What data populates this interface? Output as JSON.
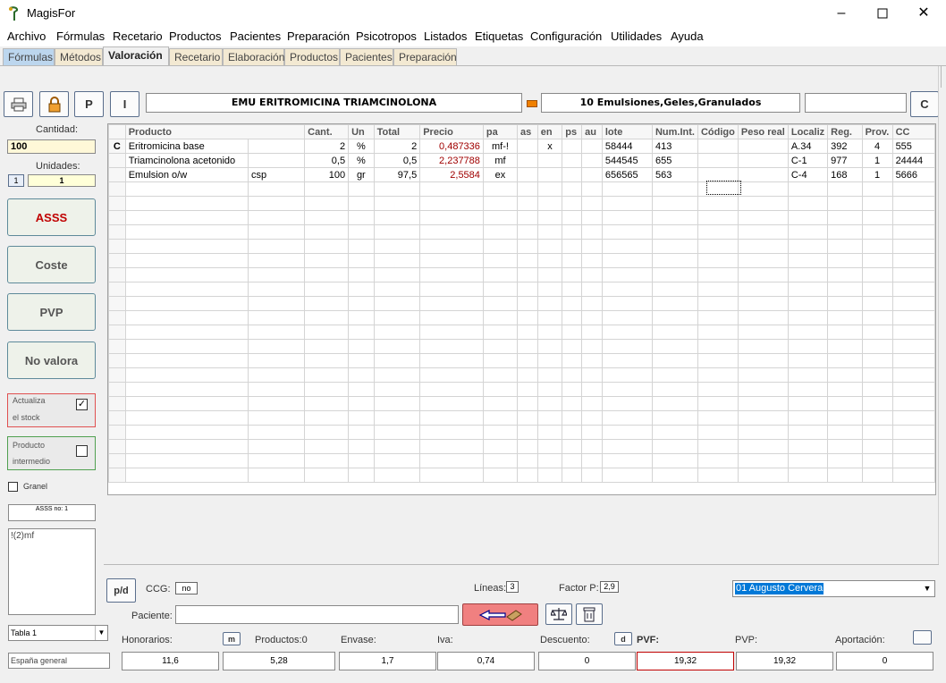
{
  "window": {
    "title": "MagisFor"
  },
  "menu": [
    "Archivo",
    "Fórmulas",
    "Recetario",
    "Productos",
    "Pacientes",
    "Preparación",
    "Psicotropos",
    "Listados",
    "Etiquetas",
    "Configuración",
    "Utilidades",
    "Ayuda"
  ],
  "tabs": [
    "Fórmulas",
    "Métodos",
    "Valoración",
    "Recetario",
    "Elaboración",
    "Productos",
    "Pacientes",
    "Preparación"
  ],
  "toolbar": {
    "p_label": "P",
    "i_label": "I",
    "formula_name": "EMU ERITROMICINA TRIAMCINOLONA",
    "form_type": "10 Emulsiones,Geles,Granulados",
    "c_label": "C"
  },
  "left": {
    "cantidad_label": "Cantidad:",
    "cantidad_value": "100",
    "unidades_label": "Unidades:",
    "unidades_small": "1",
    "unidades_value": "1",
    "btn_asss": "ASSS",
    "btn_coste": "Coste",
    "btn_pvp": "PVP",
    "btn_no_valora": "No valora",
    "actualiza_line1": "Actualiza",
    "actualiza_line2": "el stock",
    "intermedio_line1": "Producto",
    "intermedio_line2": "intermedio",
    "granel_label": "Granel",
    "asss_no": "ASSS no: 1",
    "notes": "!(2)mf",
    "tabla_value": "Tabla 1",
    "region_value": "España general"
  },
  "grid": {
    "columns": [
      "",
      "Producto",
      "Cant.",
      "Un",
      "Total",
      "Precio",
      "pa",
      "as",
      "en",
      "ps",
      "au",
      "lote",
      "Num.Int.",
      "Código",
      "Peso real",
      "Localiz",
      "Reg.",
      "Prov.",
      "CC"
    ],
    "rows": [
      [
        "C",
        "Eritromicina base",
        "",
        "2",
        "%",
        "2",
        "0,487336",
        "mf-!",
        "",
        "x",
        "",
        "",
        "58444",
        "413",
        "",
        "",
        "A.34",
        "392",
        "4",
        "555"
      ],
      [
        "",
        "Triamcinolona acetonido",
        "",
        "0,5",
        "%",
        "0,5",
        "2,237788",
        "mf",
        "",
        "",
        "",
        "",
        "544545",
        "655",
        "",
        "",
        "C-1",
        "977",
        "1",
        "24444"
      ],
      [
        "",
        "Emulsion o/w",
        "csp",
        "100",
        "gr",
        "97,5",
        "2,5584",
        "ex",
        "",
        "",
        "",
        "",
        "656565",
        "563",
        "",
        "",
        "C-4",
        "168",
        "1",
        "5666"
      ]
    ]
  },
  "bottom": {
    "pd_label": "p/d",
    "ccg_label": "CCG:",
    "ccg_value": "no",
    "lineas_label": "Líneas:",
    "lineas_value": "3",
    "factor_label": "Factor P:",
    "factor_value": "2,9",
    "patient_select": "01 Augusto Cervera",
    "paciente_label": "Paciente:",
    "paciente_value": "",
    "honorarios_label": "Honorarios:",
    "m_label": "m",
    "productos_label": "Productos:0",
    "envase_label": "Envase:",
    "iva_label": "Iva:",
    "descuento_label": "Descuento:",
    "d_label": "d",
    "pvf_label": "PVF:",
    "pvp_label": "PVP:",
    "aportacion_label": "Aportación:",
    "honorarios": "11,6",
    "productos": "5,28",
    "envase": "1,7",
    "iva": "0,74",
    "descuento": "0",
    "pvf": "19,32",
    "pvp": "19,32",
    "aportacion": "0"
  }
}
